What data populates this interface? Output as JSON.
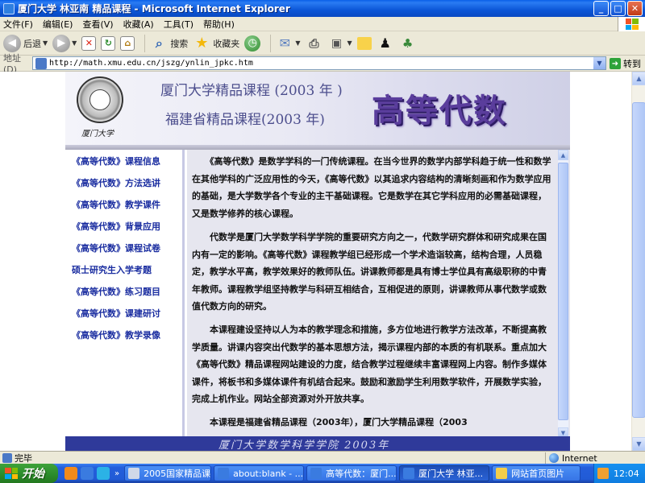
{
  "window": {
    "title": "厦门大学 林亚南 精品课程 - Microsoft Internet Explorer",
    "buttons": {
      "minimize": "_",
      "maximize": "□",
      "close": "✕"
    }
  },
  "menu": [
    "文件(F)",
    "编辑(E)",
    "查看(V)",
    "收藏(A)",
    "工具(T)",
    "帮助(H)"
  ],
  "toolbar": {
    "back_label": "后退",
    "search_label": "搜索",
    "favorites_label": "收藏夹"
  },
  "address": {
    "label": "地址(D)",
    "url": "http://math.xmu.edu.cn/jszg/ynlin_jpkc.htm",
    "go_label": "转到"
  },
  "banner": {
    "line1": "厦门大学精品课程 (2003 年 )",
    "line2": "福建省精品课程(2003 年)",
    "big_title": "高等代数",
    "seal_signature": "厦门大学"
  },
  "nav": [
    "《高等代数》课程信息",
    "《高等代数》方法选讲",
    "《高等代数》教学课件",
    "《高等代数》背景应用",
    "《高等代数》课程试卷",
    "硕士研究生入学考题",
    "《高等代数》练习题目",
    "《高等代数》课建研讨",
    "《高等代数》教学录像"
  ],
  "content": {
    "paragraphs": [
      "　　《高等代数》是数学学科的一门传统课程。在当今世界的数学内部学科趋于统一性和数学在其他学科的广泛应用性的今天，《高等代数》以其追求内容结构的清晰刻画和作为数学应用的基础，是大学数学各个专业的主干基础课程。它是数学在其它学科应用的必需基础课程，又是数学修养的核心课程。",
      "　　代数学是厦门大学数学科学学院的重要研究方向之一，代数学研究群体和研究成果在国内有一定的影响。《高等代数》课程教学组已经形成一个学术造诣较高，结构合理，人员稳定，教学水平高，教学效果好的教师队伍。讲课教师都是具有博士学位具有高级职称的中青年教师。课程教学组坚持教学与科研互相结合，互相促进的原则，讲课教师从事代数学或数值代数方向的研究。",
      "　　本课程建设坚持以人为本的教学理念和措施，多方位地进行教学方法改革，不断提高教学质量。讲课内容突出代数学的基本思想方法，揭示课程内部的本质的有机联系。重点加大《高等代数》精品课程网站建设的力度，结合教学过程继续丰富课程网上内容。制作多媒体课件，将板书和多媒体课件有机结合起来。鼓励和激励学生利用数学软件，开展数学实验，完成上机作业。网站全部资源对外开放共享。",
      "　　本课程是福建省精品课程（2003年），厦门大学精品课程（2003"
    ]
  },
  "footer": {
    "text": "厦门大学数学科学学院 2003年"
  },
  "statusbar": {
    "text": "完毕",
    "zone": "Internet"
  },
  "taskbar": {
    "start_label": "开始",
    "tasks": [
      "2005国家精品课...",
      "about:blank - ...",
      "高等代数：厦门...",
      "厦门大学 林亚...",
      "网站首页图片"
    ],
    "clock": "12:04"
  },
  "colors": {
    "nav_link": "#1a2da0",
    "banner_text": "#4c4e8d",
    "big_title": "#5a3d9c",
    "footer_bg": "#2f3a9a",
    "content_bg": "#e6e6ef"
  }
}
